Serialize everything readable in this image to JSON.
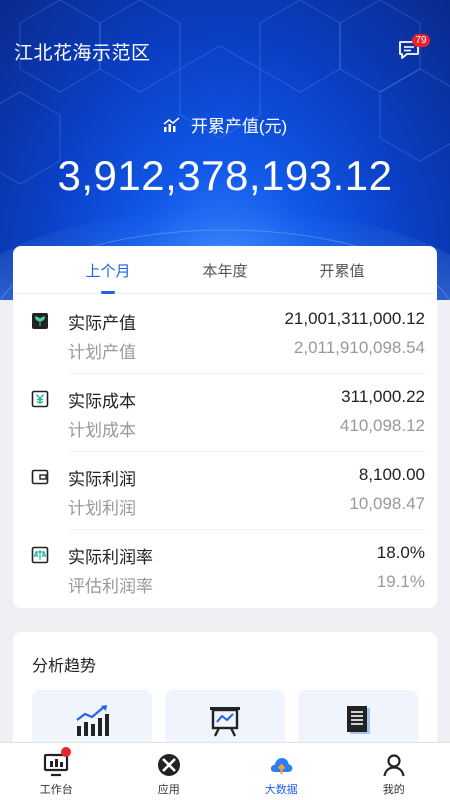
{
  "header": {
    "title": "江北花海示范区",
    "message_badge": "79",
    "label": "开累产值(元)",
    "value": "3,912,378,193.12"
  },
  "tabs": [
    {
      "label": "上个月",
      "active": true
    },
    {
      "label": "本年度",
      "active": false
    },
    {
      "label": "开累值",
      "active": false
    }
  ],
  "metrics": [
    {
      "icon": "plant-icon",
      "actual_label": "实际产值",
      "actual_value": "21,001,311,000.12",
      "plan_label": "计划产值",
      "plan_value": "2,011,910,098.54"
    },
    {
      "icon": "yuan-icon",
      "actual_label": "实际成本",
      "actual_value": "311,000.22",
      "plan_label": "计划成本",
      "plan_value": "410,098.12"
    },
    {
      "icon": "wallet-icon",
      "actual_label": "实际利润",
      "actual_value": "8,100.00",
      "plan_label": "计划利润",
      "plan_value": "10,098.47"
    },
    {
      "icon": "scale-icon",
      "actual_label": "实际利润率",
      "actual_value": "18.0%",
      "plan_label": "评估利润率",
      "plan_value": "19.1%"
    }
  ],
  "trend": {
    "title": "分析趋势",
    "tiles": [
      {
        "icon": "bar-chart-icon"
      },
      {
        "icon": "presentation-board-icon"
      },
      {
        "icon": "document-icon"
      }
    ]
  },
  "nav": [
    {
      "label": "工作台",
      "icon": "workbench-icon",
      "active": false,
      "dot": true
    },
    {
      "label": "应用",
      "icon": "apps-icon",
      "active": false
    },
    {
      "label": "大数据",
      "icon": "cloud-upload-icon",
      "active": true
    },
    {
      "label": "我的",
      "icon": "user-icon",
      "active": false
    }
  ],
  "colors": {
    "accent": "#1e63e8",
    "hero_blue": "#0a3fc4",
    "badge_red": "#e8232e"
  }
}
